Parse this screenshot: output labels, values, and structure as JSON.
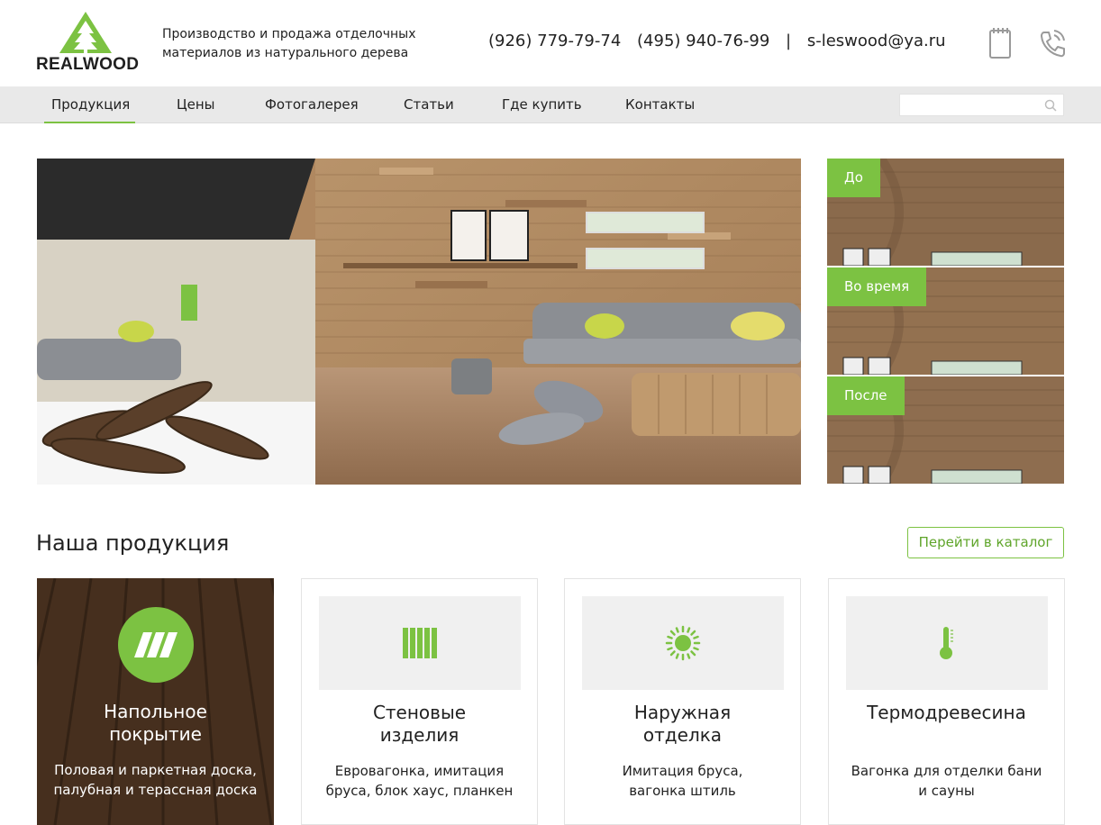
{
  "header": {
    "logo_text": "REALWOOD",
    "tagline": "Производство и продажа отделочных материалов из натурального дерева",
    "phone1": "(926) 779-79-74",
    "phone2": "(495) 940-76-99",
    "separator": "|",
    "email": "s-leswood@ya.ru",
    "icons": [
      "notepad-icon",
      "phone-icon"
    ]
  },
  "nav": {
    "items": [
      {
        "label": "Продукция",
        "active": true
      },
      {
        "label": "Цены"
      },
      {
        "label": "Фотогалерея"
      },
      {
        "label": "Статьи"
      },
      {
        "label": "Где купить"
      },
      {
        "label": "Контакты"
      }
    ],
    "search_placeholder": ""
  },
  "thumbs": [
    {
      "label": "До"
    },
    {
      "label": "Во время"
    },
    {
      "label": "После"
    }
  ],
  "products": {
    "title": "Наша продукция",
    "catalog_button": "Перейти в каталог",
    "cards": [
      {
        "title": "Напольное покрытие",
        "desc": "Половая и паркетная доска, палубная и терассная доска",
        "icon": "floor-icon"
      },
      {
        "title": "Стеновые изделия",
        "desc": "Евровагонка, имитация бруса, блок хаус, планкен",
        "icon": "wall-panels-icon"
      },
      {
        "title": "Наружная отделка",
        "desc": "Имитация бруса, вагонка штиль",
        "icon": "sun-icon"
      },
      {
        "title": "Термодревесина",
        "desc": "Вагонка для отделки бани и сауны",
        "icon": "thermometer-icon"
      }
    ]
  },
  "colors": {
    "accent": "#7cc242",
    "nav_bg": "#e9e9e9",
    "card_bg": "#f0f0f0",
    "featured_bg": "#4d3321"
  }
}
